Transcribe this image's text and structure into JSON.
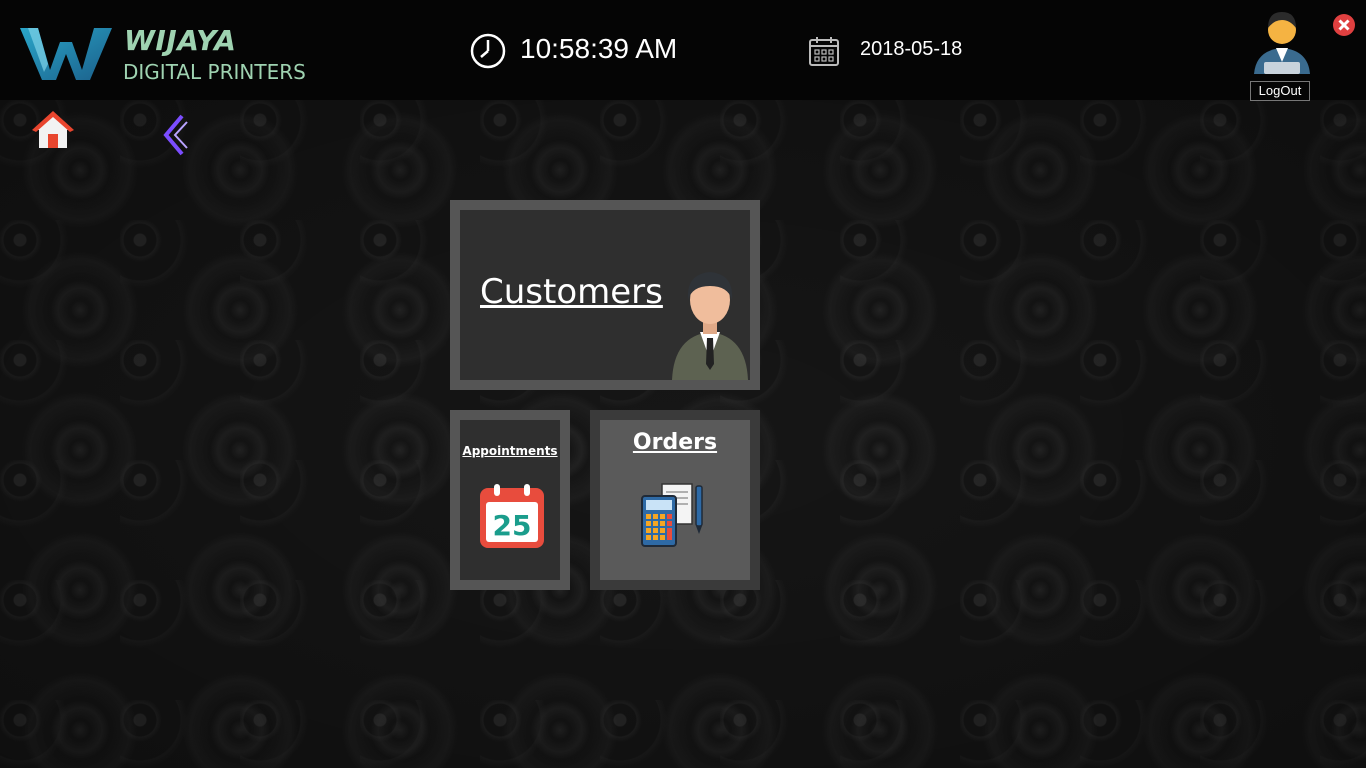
{
  "header": {
    "brand_name": "WIJAYA",
    "brand_subtitle": "DIGITAL PRINTERS",
    "time": "10:58:39 AM",
    "date": "2018-05-18",
    "logout_label": "LogOut"
  },
  "nav": {
    "home_icon": "home-icon",
    "back_icon": "chevron-left-icon"
  },
  "tiles": {
    "customers": {
      "label": "Customers",
      "icon": "businessman-icon"
    },
    "appointments": {
      "label": "Appointments",
      "icon": "calendar-icon",
      "calendar_day": "25"
    },
    "orders": {
      "label": "Orders",
      "icon": "calculator-icon"
    }
  },
  "colors": {
    "brand": "#9fd3b1",
    "header_bg": "#050505",
    "tile_border": "#555555",
    "tile_bg": "#2f2f2f",
    "orders_bg": "#5a5a5a",
    "close_red": "#e04040",
    "back_purple": "#7b4dff"
  }
}
